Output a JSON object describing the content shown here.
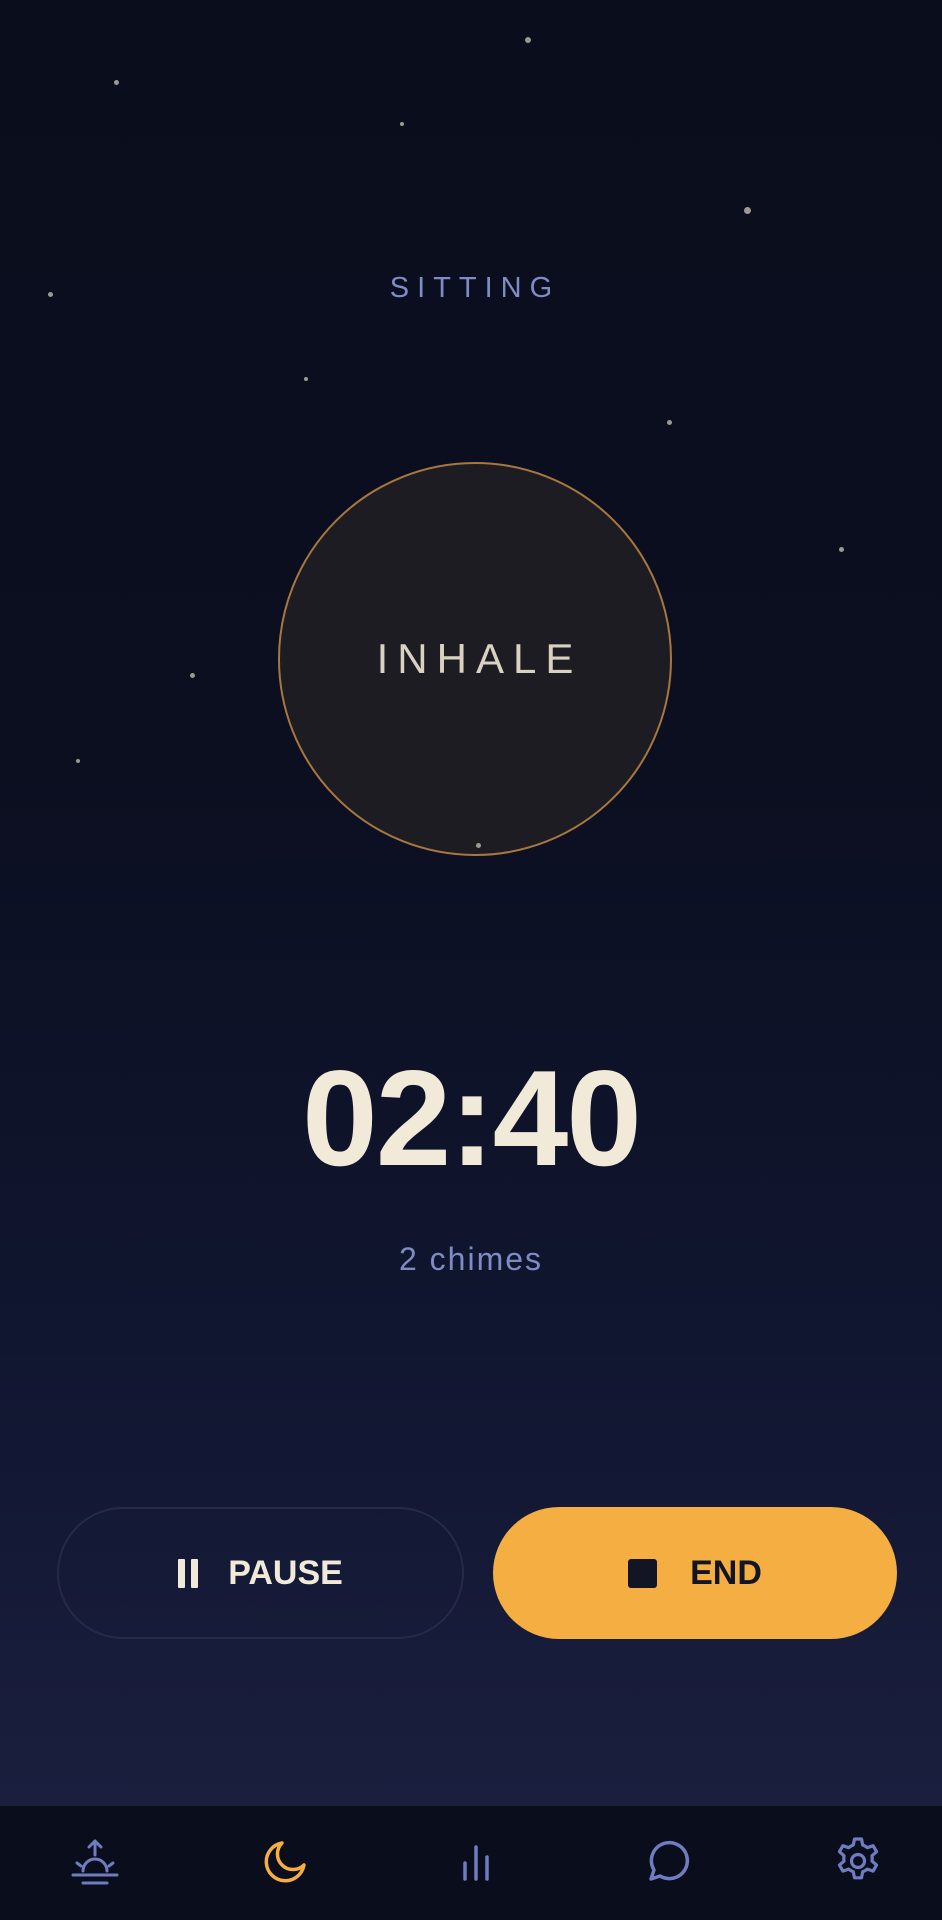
{
  "session": {
    "mode_label": "SITTING",
    "breath_phase": "INHALE",
    "timer": "02:40",
    "chimes_label": "2 chimes"
  },
  "controls": {
    "pause_label": "PAUSE",
    "end_label": "END"
  },
  "tabbar": {
    "items": [
      {
        "icon": "sunrise-icon",
        "active": false
      },
      {
        "icon": "moon-icon",
        "active": true
      },
      {
        "icon": "stats-icon",
        "active": false
      },
      {
        "icon": "chat-icon",
        "active": false
      },
      {
        "icon": "settings-icon",
        "active": false
      }
    ]
  },
  "colors": {
    "background_top": "#0a0d1c",
    "background_bottom": "#1a1f3e",
    "accent": "#f4ae42",
    "circle_border": "#a7773f",
    "muted_label": "#7f8cc4",
    "text_primary": "#f1ead8",
    "tab_inactive": "#6f7cc0"
  }
}
